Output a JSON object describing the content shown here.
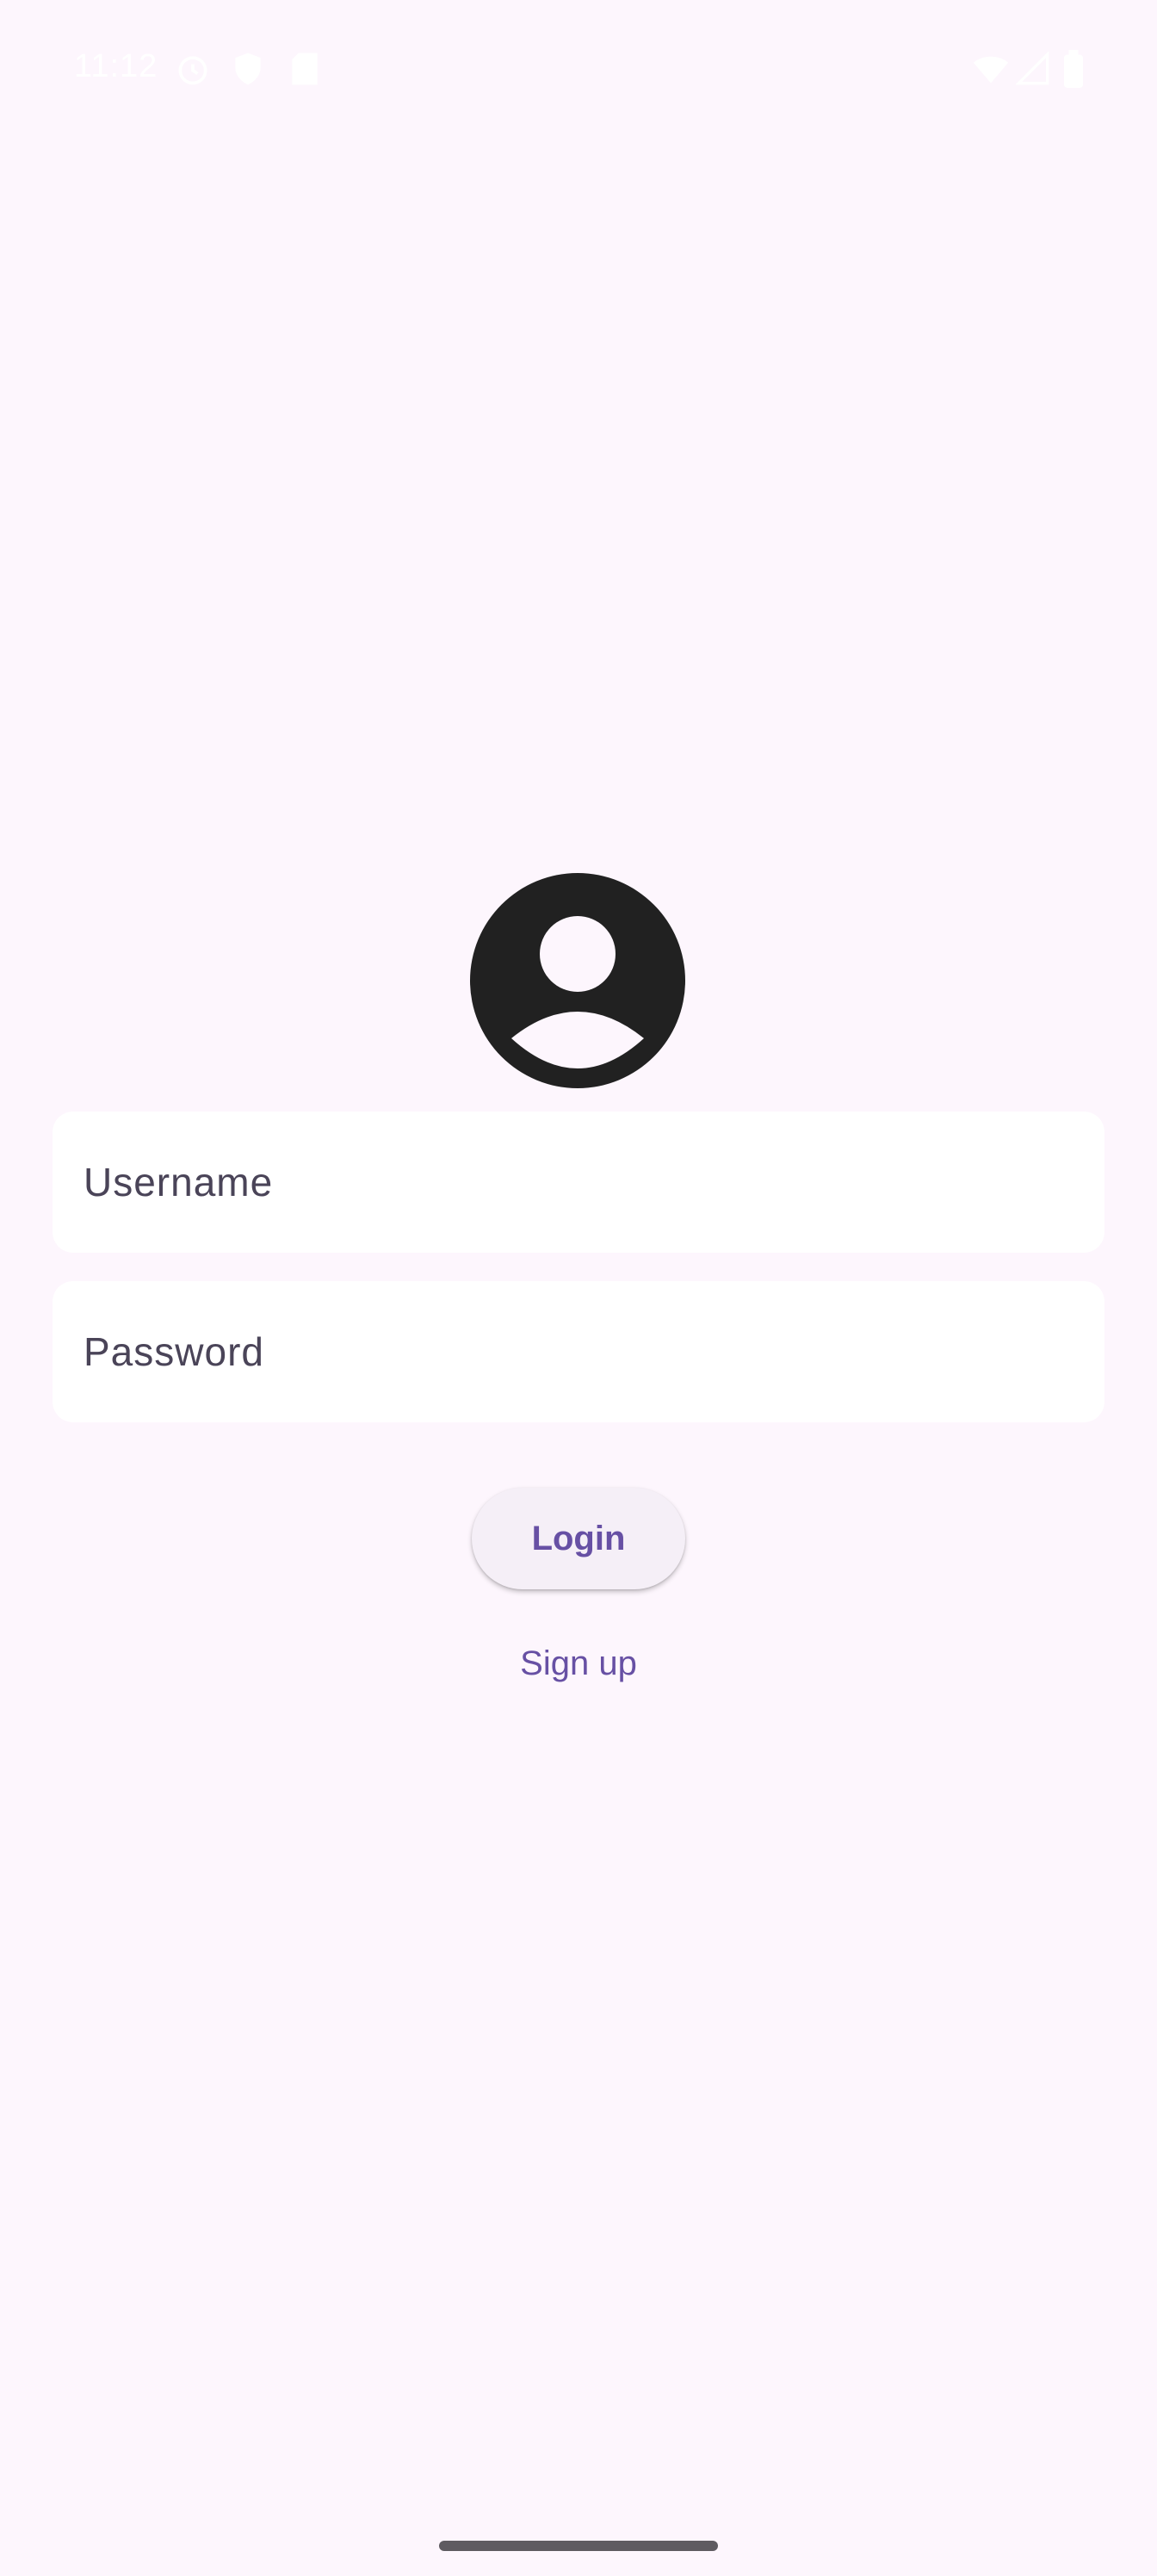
{
  "status_bar": {
    "time": "11:12",
    "left_icons": [
      "alarm-icon",
      "shield-icon",
      "sd-card-icon"
    ],
    "right_icons": [
      "wifi-icon",
      "signal-icon",
      "battery-icon"
    ]
  },
  "login": {
    "avatar_icon": "account-circle-icon",
    "username_label": "Username",
    "password_label": "Password",
    "login_button": "Login",
    "signup_link": "Sign up"
  },
  "colors": {
    "background": "#fdf6fd",
    "accent": "#6750a4",
    "field_background": "#ffffff",
    "avatar": "#212121"
  }
}
